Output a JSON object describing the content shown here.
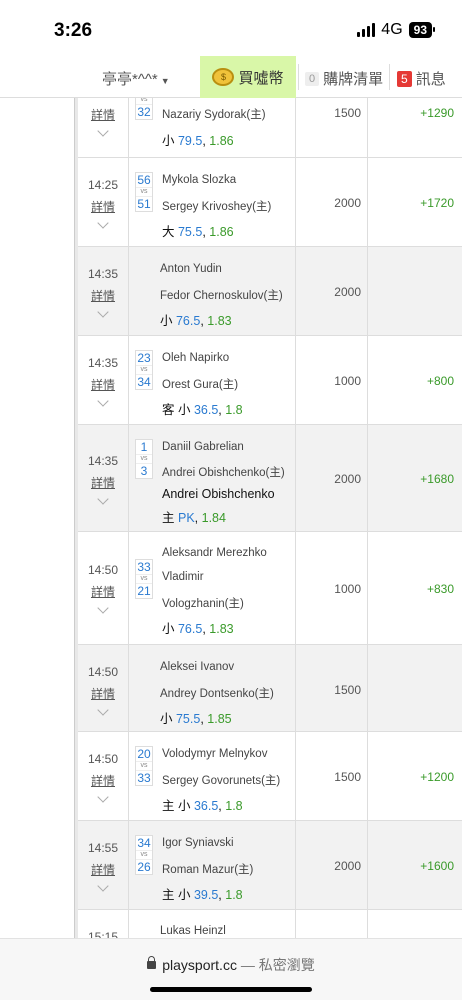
{
  "status": {
    "time": "3:26",
    "network": "4G",
    "battery": "93"
  },
  "nav": {
    "user": "亭亭*^^*",
    "coin_label": "買噓幣",
    "cart_count": "0",
    "cart_label": "購牌清單",
    "msg_count": "5",
    "msg_label": "訊息"
  },
  "rows": [
    {
      "time": "",
      "detail": "詳情",
      "score_home": "",
      "score_away": "32",
      "team1": "",
      "team2": "Nazariy Sydorak(主)",
      "pick_prefix": "小 ",
      "pick_line": "79.5",
      "pick_odds": "1.86",
      "amount": "1500",
      "profit": "+1290"
    },
    {
      "time": "14:25",
      "detail": "詳情",
      "score_home": "56",
      "score_away": "51",
      "team1": "Mykola Slozka",
      "team2": "Sergey Krivoshey(主)",
      "pick_prefix": "大 ",
      "pick_line": "75.5",
      "pick_odds": "1.86",
      "amount": "2000",
      "profit": "+1720"
    },
    {
      "time": "14:35",
      "detail": "詳情",
      "score_home": "",
      "score_away": "",
      "team1": "Anton Yudin",
      "team2": "Fedor Chernoskulov(主)",
      "pick_prefix": "小 ",
      "pick_line": "76.5",
      "pick_odds": "1.83",
      "amount": "2000",
      "profit": ""
    },
    {
      "time": "14:35",
      "detail": "詳情",
      "score_home": "23",
      "score_away": "34",
      "team1": "Oleh Napirko",
      "team2": "Orest Gura(主)",
      "pick_prefix": "客 小 ",
      "pick_line": "36.5",
      "pick_odds": "1.8",
      "amount": "1000",
      "profit": "+800"
    },
    {
      "time": "14:35",
      "detail": "詳情",
      "score_home": "1",
      "score_away": "3",
      "team1": "Daniil Gabrelian",
      "team2": "Andrei Obishchenko(主)",
      "pick_name": "Andrei Obishchenko",
      "pick_prefix": "主 ",
      "pick_line": "PK",
      "pick_odds": "1.84",
      "amount": "2000",
      "profit": "+1680"
    },
    {
      "time": "14:50",
      "detail": "詳情",
      "score_home": "33",
      "score_away": "21",
      "team1": "Aleksandr Merezhko",
      "team2": "Vladimir",
      "team3": "Vologzhanin(主)",
      "pick_prefix": "小 ",
      "pick_line": "76.5",
      "pick_odds": "1.83",
      "amount": "1000",
      "profit": "+830"
    },
    {
      "time": "14:50",
      "detail": "詳情",
      "score_home": "",
      "score_away": "",
      "team1": "Aleksei Ivanov",
      "team2": "Andrey Dontsenko(主)",
      "pick_prefix": "小 ",
      "pick_line": "75.5",
      "pick_odds": "1.85",
      "amount": "1500",
      "profit": ""
    },
    {
      "time": "14:50",
      "detail": "詳情",
      "score_home": "20",
      "score_away": "33",
      "team1": "Volodymyr Melnykov",
      "team2": "Sergey Govorunets(主)",
      "pick_prefix": "主 小 ",
      "pick_line": "36.5",
      "pick_odds": "1.8",
      "amount": "1500",
      "profit": "+1200"
    },
    {
      "time": "14:55",
      "detail": "詳情",
      "score_home": "34",
      "score_away": "26",
      "team1": "Igor Syniavski",
      "team2": "Roman Mazur(主)",
      "pick_prefix": "主 小 ",
      "pick_line": "39.5",
      "pick_odds": "1.8",
      "amount": "2000",
      "profit": "+1600"
    },
    {
      "time": "15:15",
      "detail": "",
      "score_home": "",
      "score_away": "",
      "team1": "Lukas Heinzl",
      "team2": "",
      "pick_prefix": "",
      "pick_line": "",
      "pick_odds": "",
      "amount": "",
      "profit": ""
    }
  ],
  "browser": {
    "domain": "playsport.cc",
    "mode": "— 私密瀏覽"
  }
}
